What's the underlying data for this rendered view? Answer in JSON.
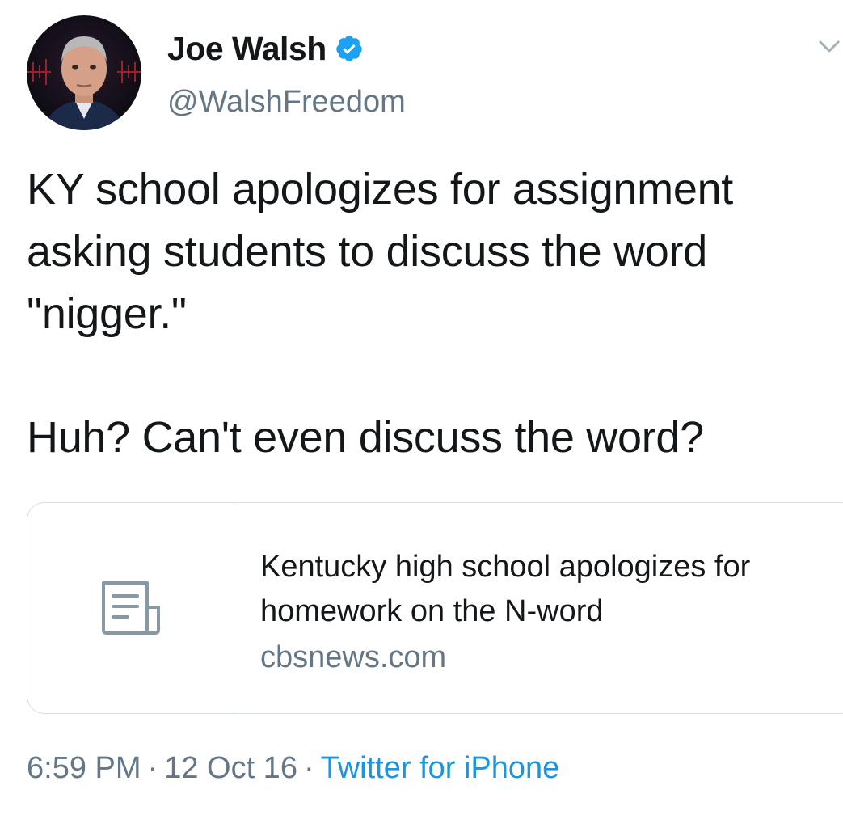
{
  "author": {
    "display_name": "Joe Walsh",
    "handle": "@WalshFreedom",
    "verified": true,
    "avatar_icon": "profile-photo"
  },
  "tweet": {
    "text_paragraph_1": "KY school apologizes for assignment\nasking students to discuss the word\n\"nigger.\"",
    "text_paragraph_2": "Huh? Can't even discuss the word?"
  },
  "link_card": {
    "thumbnail_icon": "document-icon",
    "title": "Kentucky high school apologizes for homework on the N-word",
    "domain": "cbsnews.com"
  },
  "meta": {
    "time": "6:59 PM",
    "separator": "·",
    "date": "12 Oct 16",
    "source": "Twitter for iPhone"
  },
  "colors": {
    "text": "#14171a",
    "secondary": "#657786",
    "accent": "#1b95e0",
    "border": "#d6dde3"
  }
}
